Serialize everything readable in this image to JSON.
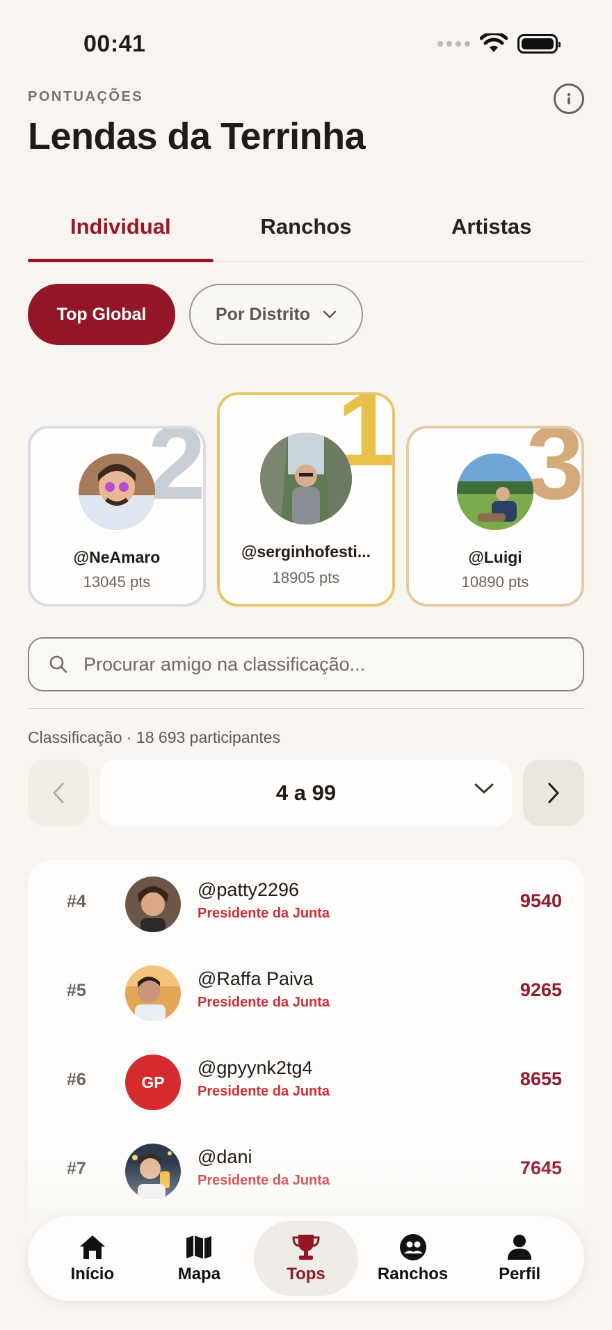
{
  "status_bar": {
    "time": "00:41"
  },
  "header": {
    "eyebrow": "PONTUAÇÕES",
    "title": "Lendas da Terrinha"
  },
  "tabs": [
    {
      "label": "Individual",
      "active": true
    },
    {
      "label": "Ranchos",
      "active": false
    },
    {
      "label": "Artistas",
      "active": false
    }
  ],
  "filters": {
    "top_global": "Top Global",
    "por_distrito": "Por Distrito"
  },
  "podium": {
    "first": {
      "rank": "1",
      "name": "@serginhofesti...",
      "points": "18905 pts"
    },
    "second": {
      "rank": "2",
      "name": "@NeAmaro",
      "points": "13045 pts"
    },
    "third": {
      "rank": "3",
      "name": "@Luigi",
      "points": "10890 pts"
    }
  },
  "search": {
    "placeholder": "Procurar amigo na classificação..."
  },
  "classification": {
    "info": "Classificação · 18 693 participantes"
  },
  "pager": {
    "range": "4 a 99"
  },
  "ranking": [
    {
      "position": "#4",
      "name": "@patty2296",
      "role": "Presidente da Junta",
      "score": "9540"
    },
    {
      "position": "#5",
      "name": "@Raffa Paiva",
      "role": "Presidente da Junta",
      "score": "9265"
    },
    {
      "position": "#6",
      "name": "@gpyynk2tg4",
      "role": "Presidente da Junta",
      "score": "8655",
      "initials": "GP"
    },
    {
      "position": "#7",
      "name": "@dani",
      "role": "Presidente da Junta",
      "score": "7645"
    }
  ],
  "nav": [
    {
      "label": "Início",
      "icon": "home-icon"
    },
    {
      "label": "Mapa",
      "icon": "map-icon"
    },
    {
      "label": "Tops",
      "icon": "trophy-icon",
      "active": true
    },
    {
      "label": "Ranchos",
      "icon": "group-icon"
    },
    {
      "label": "Perfil",
      "icon": "person-icon"
    }
  ],
  "colors": {
    "accent": "#921626",
    "gold": "#e8c14c",
    "silver": "#c7ced6",
    "bronze": "#d3ab7a",
    "role": "#cf3037"
  }
}
